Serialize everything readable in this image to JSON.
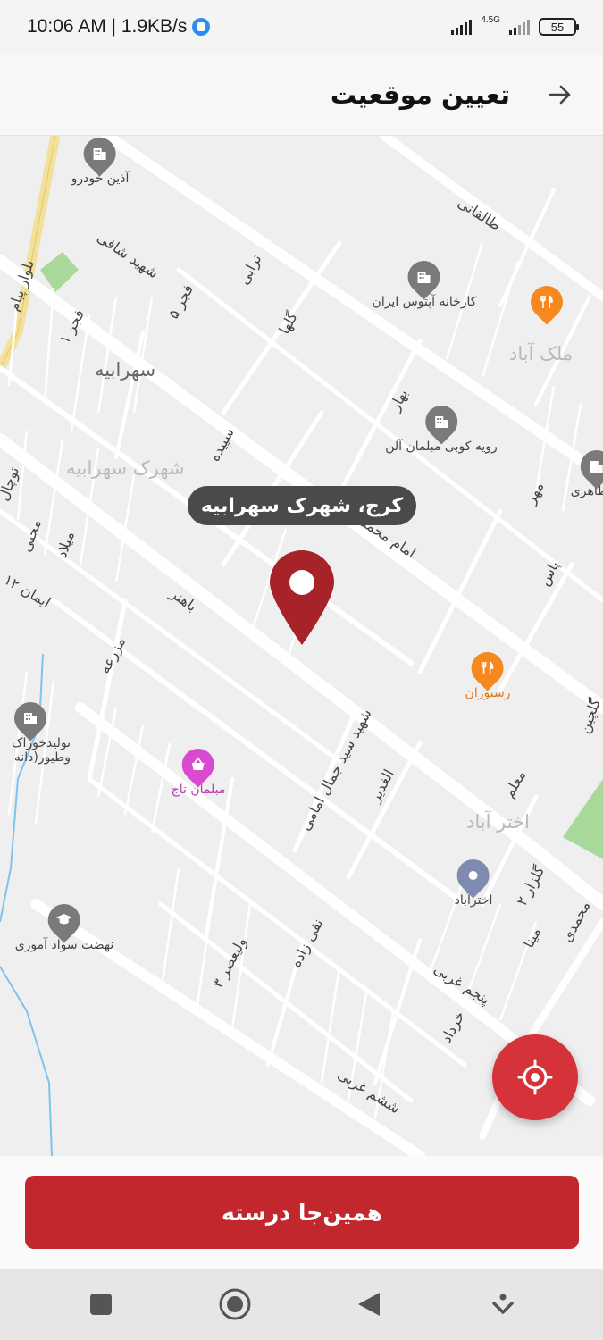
{
  "status_bar": {
    "time_speed": "10:06 AM | 1.9KB/s",
    "network_label": "4.5G",
    "battery": "55"
  },
  "app_bar": {
    "title": "تعیین موقعیت"
  },
  "map": {
    "areas": [
      "شهرک سهرابیه",
      "ملک آباد",
      "اختر آباد",
      "سهرابیه"
    ],
    "streets": [
      "طالقانی",
      "امام محمد",
      "باهنر",
      "شهید سید جمال امامی",
      "پنجم غربی",
      "ششم غربی",
      "الغدیر",
      "معلم",
      "مزرعه",
      "بلوار پیام",
      "شهید شافی",
      "فجر ۵",
      "فجر ۱",
      "ترابی",
      "گلها",
      "سپیده",
      "بهار",
      "مهر",
      "پاس",
      "میلاد",
      "محبی",
      "ایمان ۱۲",
      "توچال",
      "نقی زاده",
      "ولیعصر ۳",
      "خرداد",
      "مینا",
      "گلزار ۲",
      "محمدی",
      "گلچین"
    ],
    "pois": [
      {
        "label": "آذین خودرو",
        "icon": "building-icon"
      },
      {
        "label": "کارخانه آپتوس ایران",
        "icon": "building-icon"
      },
      {
        "label": "رویه کوبی مبلمان آلن",
        "icon": "building-icon"
      },
      {
        "label": "تولیدخوراک وطیور(دانه",
        "icon": "building-icon"
      },
      {
        "label": "مبلمان تاج",
        "icon": "shopping-basket-icon"
      },
      {
        "label": "رستوران",
        "icon": "restaurant-icon"
      },
      {
        "label": "اخترآباد",
        "icon": "location-pin-icon"
      },
      {
        "label": "نهضت سواد آموزی",
        "icon": "graduation-cap-icon"
      },
      {
        "label": "ک طاهری",
        "icon": "building-icon"
      }
    ],
    "selected_location": "کرج، شهرک سهرابیه"
  },
  "confirm_button": "همین‌جا درسته",
  "colors": {
    "primary": "#c2272d",
    "fab": "#d6323a",
    "tooltip": "#4a4a4a",
    "restaurant": "#f5891f",
    "shop": "#d94ad0",
    "poi_gray": "#7a7a7a",
    "place_blue": "#7e8ab0"
  }
}
